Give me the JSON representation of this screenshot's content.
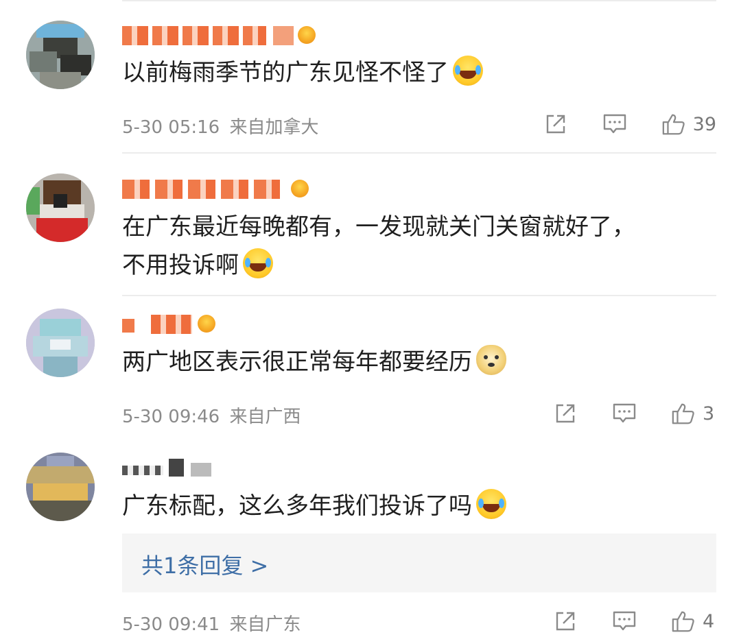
{
  "comments": [
    {
      "text": "以前梅雨季节的广东见怪不怪了",
      "emoji": "laugh-cry-emoji",
      "date": "5-30 05:16",
      "location": "来自加拿大",
      "likes": "39"
    },
    {
      "text_line1": "在广东最近每晚都有，一发现就关门关窗就好了，",
      "text_line2": "不用投诉啊",
      "emoji": "laugh-cry-emoji"
    },
    {
      "text": "两广地区表示很正常每年都要经历",
      "emoji": "doge-emoji",
      "date": "5-30 09:46",
      "location": "来自广西",
      "likes": "3"
    },
    {
      "text": "广东标配，这么多年我们投诉了吗",
      "emoji": "laugh-cry-emoji",
      "reply_link": "共1条回复 >",
      "date": "5-30 09:41",
      "location": "来自广东",
      "likes": "4"
    }
  ],
  "icons": {
    "share": "share-icon",
    "comment": "comment-icon",
    "like": "like-icon",
    "crown": "vip-crown-icon"
  },
  "colors": {
    "text": "#1f1f1f",
    "meta": "#8a8a8a",
    "link": "#3e6ea6",
    "reply_bg": "#f5f5f5",
    "username_pixel": "#f07a4a"
  }
}
